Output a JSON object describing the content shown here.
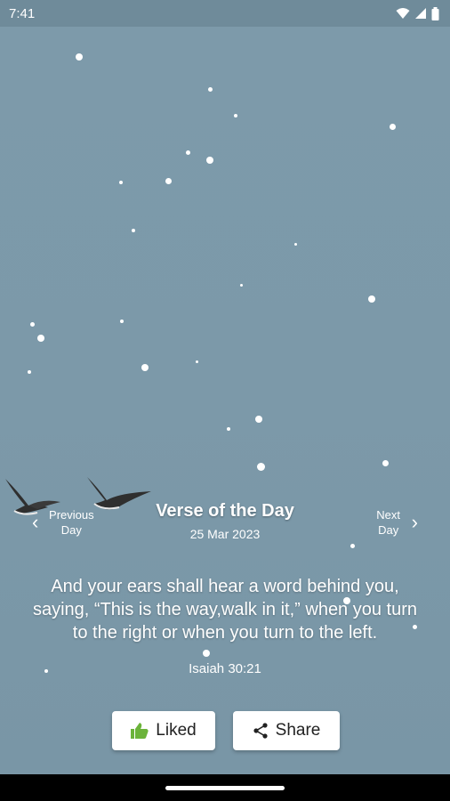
{
  "status_bar": {
    "time": "7:41"
  },
  "header": {
    "title": "Verse of the Day",
    "date": "25 Mar 2023"
  },
  "nav": {
    "prev_label": "Previous Day",
    "next_label": "Next Day"
  },
  "verse": {
    "text": "And your ears shall hear a word behind you, saying, “This is the way,walk in it,” when you turn to the right or when you turn to the left.",
    "reference": "Isaiah 30:21"
  },
  "actions": {
    "like_label": "Liked",
    "share_label": "Share"
  },
  "colors": {
    "sky": "#7896a6",
    "like_icon": "#6bb33a"
  }
}
